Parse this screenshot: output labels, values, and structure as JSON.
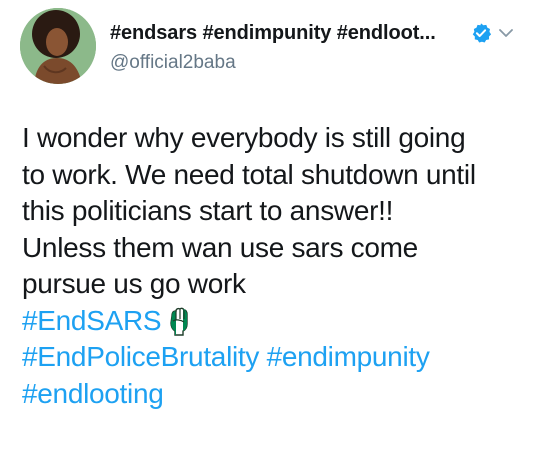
{
  "user": {
    "display_name": "#endsars #endimpunity #endloot...",
    "handle": "@official2baba",
    "verified": true,
    "avatar_icon": "profile-photo"
  },
  "tweet": {
    "lines": [
      "I wonder why everybody is still going",
      "to work. We need total shutdown until",
      "this politicians start to answer!!",
      "Unless them wan use sars come",
      "pursue us go work"
    ],
    "hashtags": {
      "line1": "#EndSARS",
      "line2_a": "#EndPoliceBrutality",
      "line2_b": "#endimpunity",
      "line3": "#endlooting"
    },
    "emoji": "raised-fist-nigeria-flag"
  },
  "colors": {
    "text": "#14171a",
    "secondary": "#657786",
    "link": "#1da1f2",
    "verified": "#1da1f2",
    "flag_green": "#008751"
  }
}
